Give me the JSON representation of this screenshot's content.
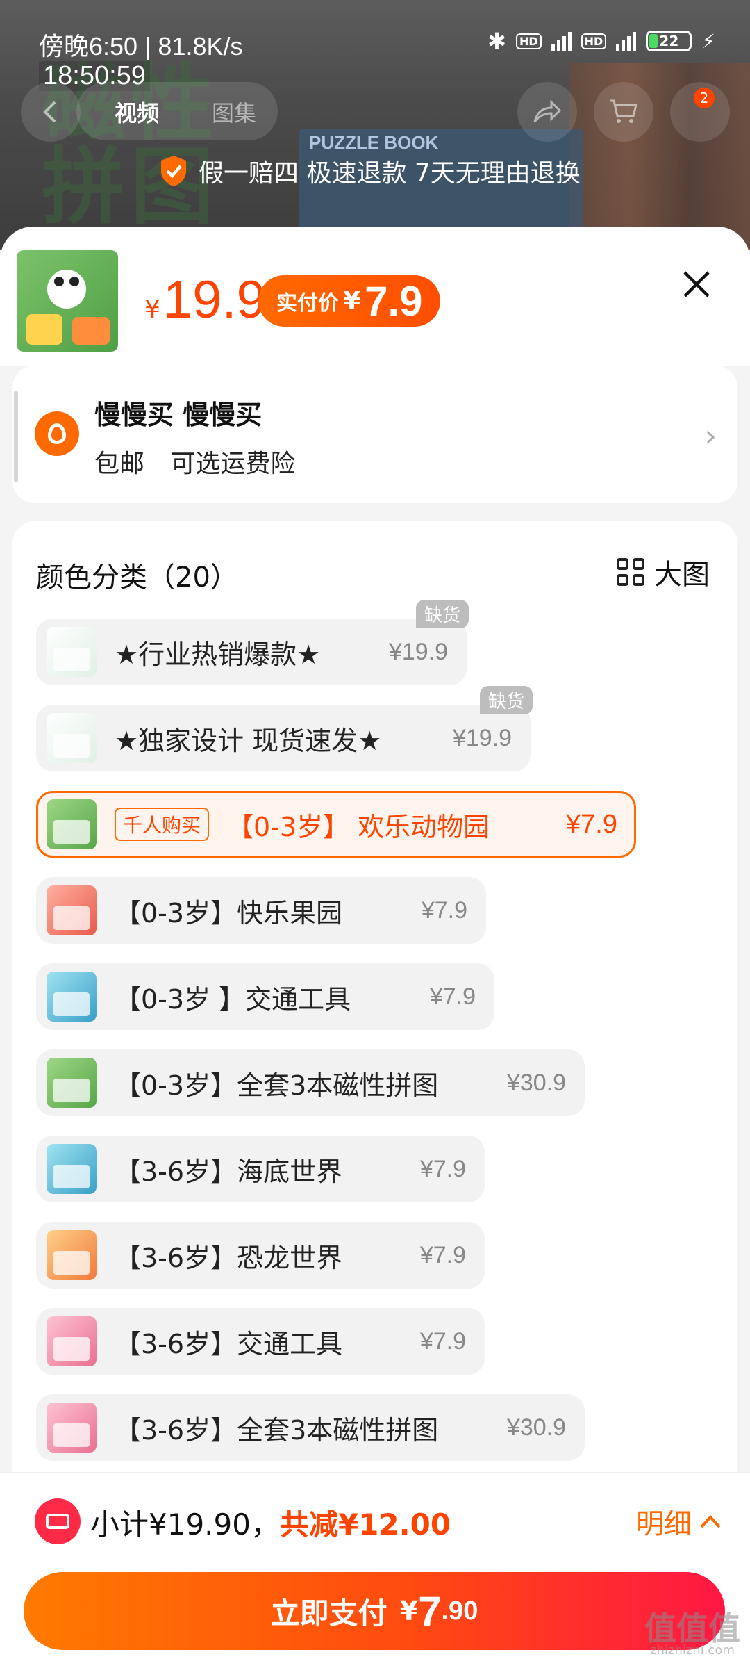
{
  "status": {
    "left": "傍晚6:50 | 81.8K/s",
    "battery": "22",
    "overlay_time": "18:50:59"
  },
  "nav": {
    "tabs": [
      {
        "label": "视频"
      },
      {
        "label": "图集"
      }
    ],
    "cart_badge": "2"
  },
  "background": {
    "big_text": "磁性\n拼图",
    "book_text": "PUZZLE BOOK"
  },
  "guarantee": "假一赔四 极速退款 7天无理由退换",
  "sku_header": {
    "currency": "¥",
    "price": "19.9",
    "real_label": "实付价",
    "real_currency": "¥",
    "real_price": "7.9"
  },
  "address": {
    "name": "慢慢买 慢慢买",
    "shipping": [
      "包邮",
      "可选运费险"
    ]
  },
  "options_section": {
    "title": "颜色分类（20）",
    "big_view": "大图",
    "items": [
      {
        "label": "★行业热销爆款★",
        "price": "¥19.9",
        "badge": "缺货",
        "swatch": "sw-white",
        "selected": false
      },
      {
        "label": "★独家设计 现货速发★",
        "price": "¥19.9",
        "badge": "缺货",
        "swatch": "sw-white",
        "selected": false
      },
      {
        "label": "【0-3岁】 欢乐动物园",
        "price": "¥7.9",
        "hot": "千人购买",
        "swatch": "sw-green",
        "selected": true
      },
      {
        "label": "【0-3岁】快乐果园",
        "price": "¥7.9",
        "swatch": "sw-red",
        "selected": false
      },
      {
        "label": "【0-3岁 】交通工具",
        "price": "¥7.9",
        "swatch": "sw-teal",
        "selected": false
      },
      {
        "label": "【0-3岁】全套3本磁性拼图",
        "price": "¥30.9",
        "swatch": "sw-green",
        "selected": false
      },
      {
        "label": "【3-6岁】海底世界",
        "price": "¥7.9",
        "swatch": "sw-teal",
        "selected": false
      },
      {
        "label": "【3-6岁】恐龙世界",
        "price": "¥7.9",
        "swatch": "sw-orange",
        "selected": false
      },
      {
        "label": "【3-6岁】交通工具",
        "price": "¥7.9",
        "swatch": "sw-pink",
        "selected": false
      },
      {
        "label": "【3-6岁】全套3本磁性拼图",
        "price": "¥30.9",
        "swatch": "sw-pink",
        "selected": false
      }
    ]
  },
  "bottom": {
    "subtotal": "小计¥19.90，",
    "discount": "共减¥12.00",
    "detail": "明细",
    "pay_label": "立即支付",
    "pay_currency": "¥",
    "pay_int": "7",
    "pay_dec": ".90"
  },
  "watermark": {
    "big": "值值值",
    "small": "zhizhizhi.com"
  },
  "colors": {
    "accent": "#ff4400",
    "accent_orange": "#ff6a00",
    "pay_end": "#ff1744"
  }
}
